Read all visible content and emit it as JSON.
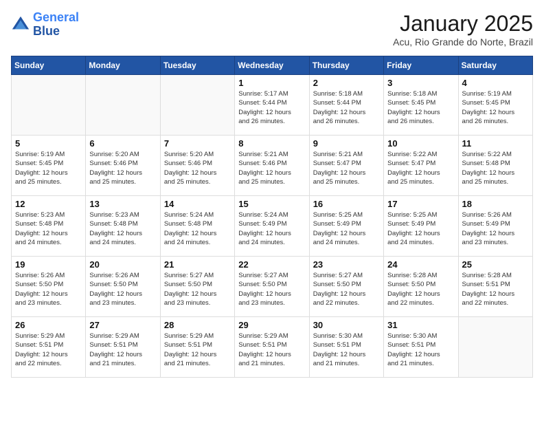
{
  "logo": {
    "line1": "General",
    "line2": "Blue"
  },
  "title": "January 2025",
  "subtitle": "Acu, Rio Grande do Norte, Brazil",
  "days_of_week": [
    "Sunday",
    "Monday",
    "Tuesday",
    "Wednesday",
    "Thursday",
    "Friday",
    "Saturday"
  ],
  "weeks": [
    [
      {
        "day": "",
        "info": ""
      },
      {
        "day": "",
        "info": ""
      },
      {
        "day": "",
        "info": ""
      },
      {
        "day": "1",
        "info": "Sunrise: 5:17 AM\nSunset: 5:44 PM\nDaylight: 12 hours\nand 26 minutes."
      },
      {
        "day": "2",
        "info": "Sunrise: 5:18 AM\nSunset: 5:44 PM\nDaylight: 12 hours\nand 26 minutes."
      },
      {
        "day": "3",
        "info": "Sunrise: 5:18 AM\nSunset: 5:45 PM\nDaylight: 12 hours\nand 26 minutes."
      },
      {
        "day": "4",
        "info": "Sunrise: 5:19 AM\nSunset: 5:45 PM\nDaylight: 12 hours\nand 26 minutes."
      }
    ],
    [
      {
        "day": "5",
        "info": "Sunrise: 5:19 AM\nSunset: 5:45 PM\nDaylight: 12 hours\nand 25 minutes."
      },
      {
        "day": "6",
        "info": "Sunrise: 5:20 AM\nSunset: 5:46 PM\nDaylight: 12 hours\nand 25 minutes."
      },
      {
        "day": "7",
        "info": "Sunrise: 5:20 AM\nSunset: 5:46 PM\nDaylight: 12 hours\nand 25 minutes."
      },
      {
        "day": "8",
        "info": "Sunrise: 5:21 AM\nSunset: 5:46 PM\nDaylight: 12 hours\nand 25 minutes."
      },
      {
        "day": "9",
        "info": "Sunrise: 5:21 AM\nSunset: 5:47 PM\nDaylight: 12 hours\nand 25 minutes."
      },
      {
        "day": "10",
        "info": "Sunrise: 5:22 AM\nSunset: 5:47 PM\nDaylight: 12 hours\nand 25 minutes."
      },
      {
        "day": "11",
        "info": "Sunrise: 5:22 AM\nSunset: 5:48 PM\nDaylight: 12 hours\nand 25 minutes."
      }
    ],
    [
      {
        "day": "12",
        "info": "Sunrise: 5:23 AM\nSunset: 5:48 PM\nDaylight: 12 hours\nand 24 minutes."
      },
      {
        "day": "13",
        "info": "Sunrise: 5:23 AM\nSunset: 5:48 PM\nDaylight: 12 hours\nand 24 minutes."
      },
      {
        "day": "14",
        "info": "Sunrise: 5:24 AM\nSunset: 5:48 PM\nDaylight: 12 hours\nand 24 minutes."
      },
      {
        "day": "15",
        "info": "Sunrise: 5:24 AM\nSunset: 5:49 PM\nDaylight: 12 hours\nand 24 minutes."
      },
      {
        "day": "16",
        "info": "Sunrise: 5:25 AM\nSunset: 5:49 PM\nDaylight: 12 hours\nand 24 minutes."
      },
      {
        "day": "17",
        "info": "Sunrise: 5:25 AM\nSunset: 5:49 PM\nDaylight: 12 hours\nand 24 minutes."
      },
      {
        "day": "18",
        "info": "Sunrise: 5:26 AM\nSunset: 5:49 PM\nDaylight: 12 hours\nand 23 minutes."
      }
    ],
    [
      {
        "day": "19",
        "info": "Sunrise: 5:26 AM\nSunset: 5:50 PM\nDaylight: 12 hours\nand 23 minutes."
      },
      {
        "day": "20",
        "info": "Sunrise: 5:26 AM\nSunset: 5:50 PM\nDaylight: 12 hours\nand 23 minutes."
      },
      {
        "day": "21",
        "info": "Sunrise: 5:27 AM\nSunset: 5:50 PM\nDaylight: 12 hours\nand 23 minutes."
      },
      {
        "day": "22",
        "info": "Sunrise: 5:27 AM\nSunset: 5:50 PM\nDaylight: 12 hours\nand 23 minutes."
      },
      {
        "day": "23",
        "info": "Sunrise: 5:27 AM\nSunset: 5:50 PM\nDaylight: 12 hours\nand 22 minutes."
      },
      {
        "day": "24",
        "info": "Sunrise: 5:28 AM\nSunset: 5:50 PM\nDaylight: 12 hours\nand 22 minutes."
      },
      {
        "day": "25",
        "info": "Sunrise: 5:28 AM\nSunset: 5:51 PM\nDaylight: 12 hours\nand 22 minutes."
      }
    ],
    [
      {
        "day": "26",
        "info": "Sunrise: 5:29 AM\nSunset: 5:51 PM\nDaylight: 12 hours\nand 22 minutes."
      },
      {
        "day": "27",
        "info": "Sunrise: 5:29 AM\nSunset: 5:51 PM\nDaylight: 12 hours\nand 21 minutes."
      },
      {
        "day": "28",
        "info": "Sunrise: 5:29 AM\nSunset: 5:51 PM\nDaylight: 12 hours\nand 21 minutes."
      },
      {
        "day": "29",
        "info": "Sunrise: 5:29 AM\nSunset: 5:51 PM\nDaylight: 12 hours\nand 21 minutes."
      },
      {
        "day": "30",
        "info": "Sunrise: 5:30 AM\nSunset: 5:51 PM\nDaylight: 12 hours\nand 21 minutes."
      },
      {
        "day": "31",
        "info": "Sunrise: 5:30 AM\nSunset: 5:51 PM\nDaylight: 12 hours\nand 21 minutes."
      },
      {
        "day": "",
        "info": ""
      }
    ]
  ]
}
